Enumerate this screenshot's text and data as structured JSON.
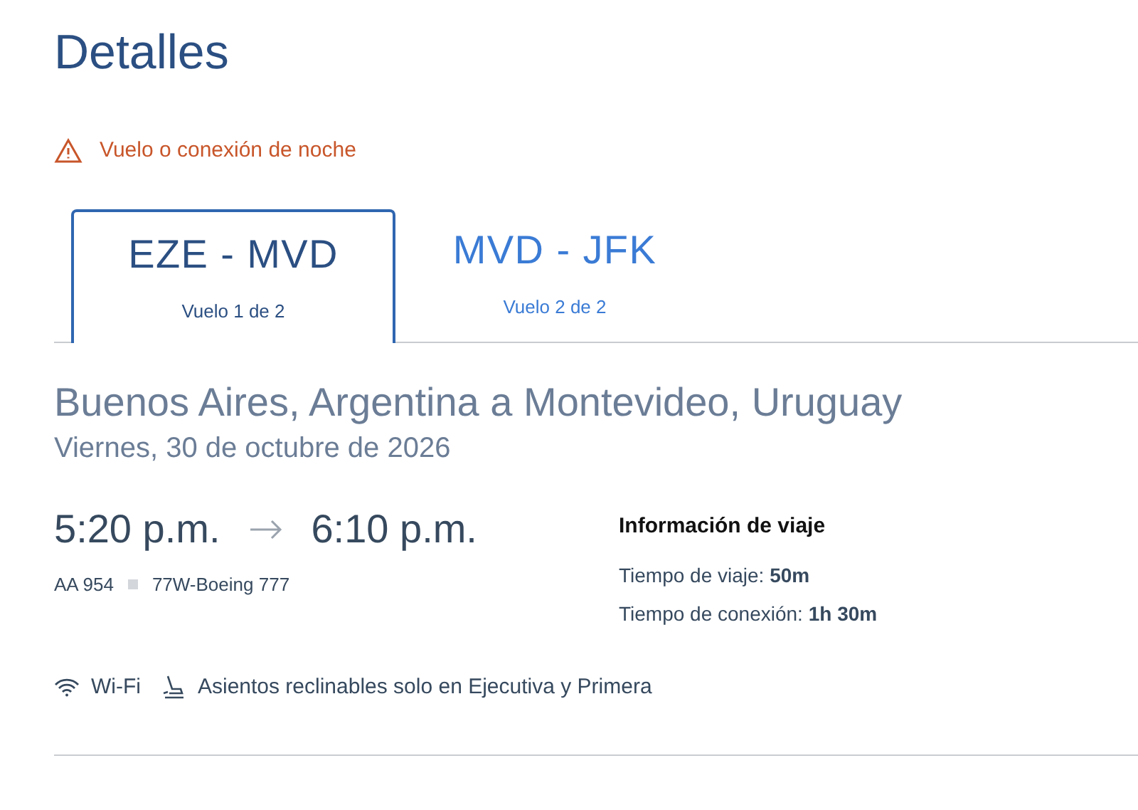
{
  "title": "Detalles",
  "alert": {
    "text": "Vuelo o conexión de noche"
  },
  "tabs": [
    {
      "route": "EZE - MVD",
      "subtitle": "Vuelo 1 de 2",
      "selected": true
    },
    {
      "route": "MVD - JFK",
      "subtitle": "Vuelo 2 de 2",
      "selected": false
    }
  ],
  "segment": {
    "heading": "Buenos Aires, Argentina a Montevideo, Uruguay",
    "date": "Viernes, 30 de octubre de 2026",
    "depart": "5:20 p.m.",
    "arrive": "6:10 p.m.",
    "flight": "AA 954",
    "aircraft": "77W-Boeing 777"
  },
  "info": {
    "title": "Información de viaje",
    "rows": [
      "Tiempo de viaje: **50m**",
      "Tiempo de conexión: **1h 30m**"
    ]
  },
  "amenities": [
    {
      "kind": "wifi",
      "label": "Wi-Fi"
    },
    {
      "kind": "seat",
      "label": "Asientos reclinables solo en Ejecutiva y Primera"
    }
  ]
}
